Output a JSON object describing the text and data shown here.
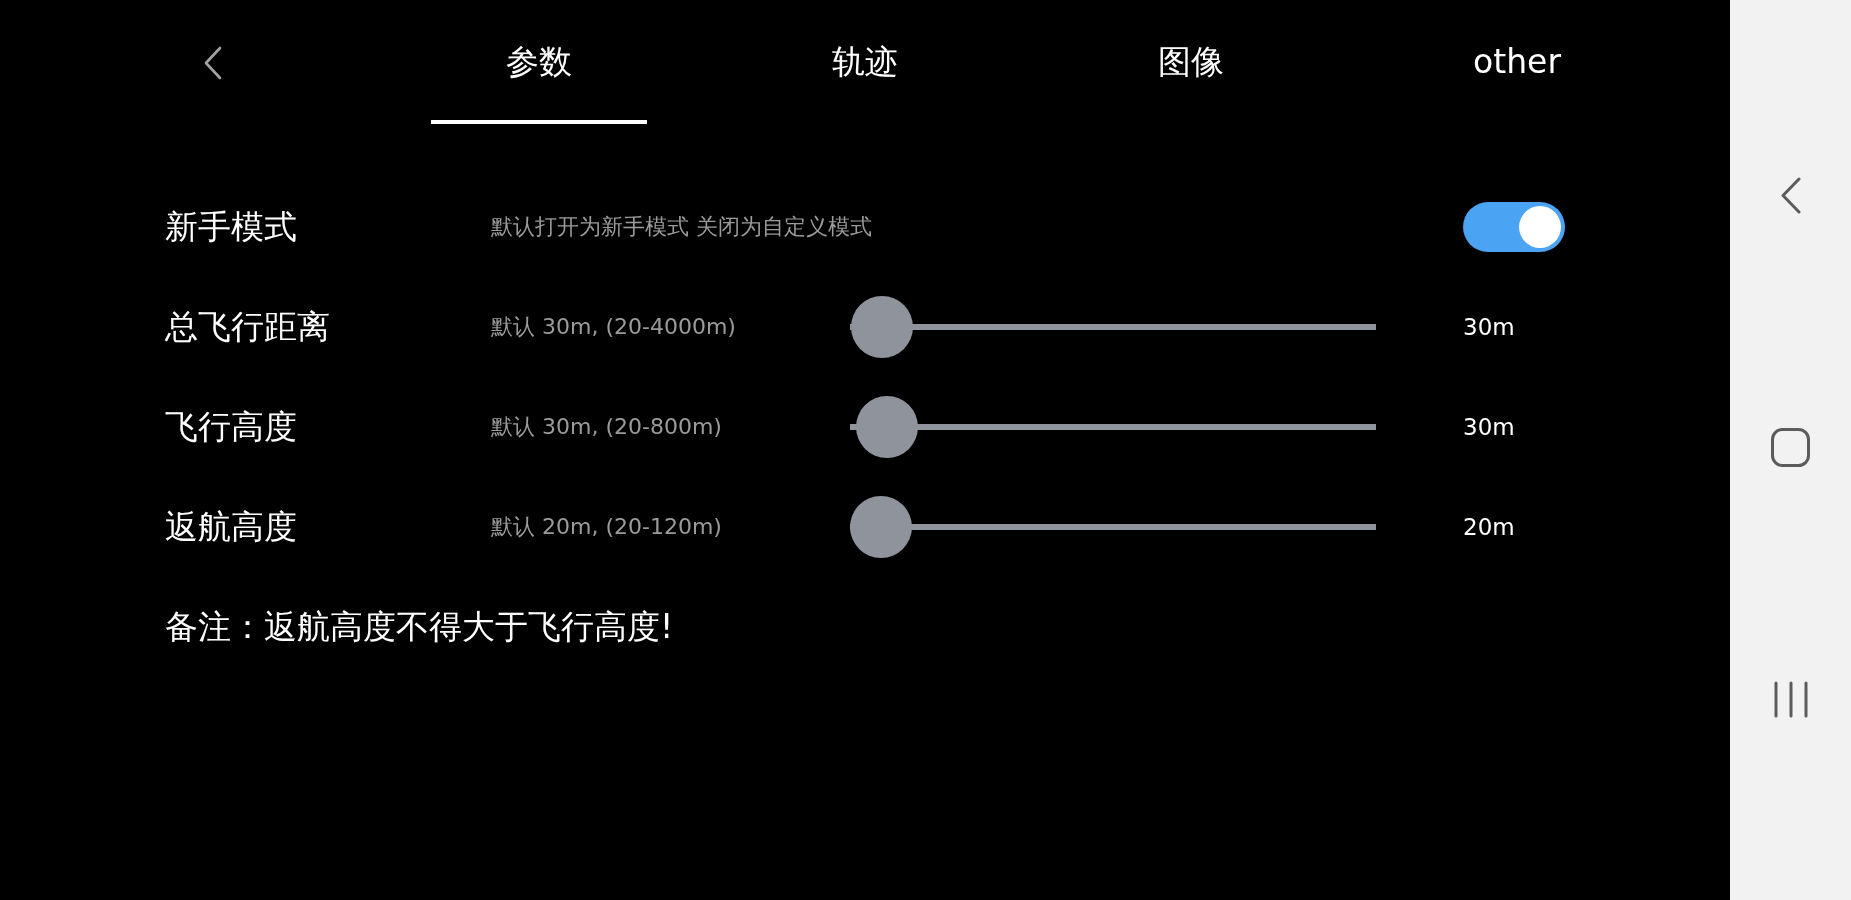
{
  "tab_bar": {
    "tabs": [
      {
        "label": "参数",
        "selected": true
      },
      {
        "label": "轨迹",
        "selected": false
      },
      {
        "label": "图像",
        "selected": false
      },
      {
        "label": "other",
        "selected": false
      }
    ]
  },
  "settings": [
    {
      "kind": "toggle",
      "label": "新手模式",
      "description": "默认打开为新手模式 关闭为自定义模式",
      "on": true
    },
    {
      "kind": "slider",
      "label": "总飞行距离",
      "description": "默认 30m, (20-4000m)",
      "level": 0.003,
      "reading": "30m"
    },
    {
      "kind": "slider",
      "label": "飞行高度",
      "description": "默认 30m, (20-800m)",
      "level": 0.013,
      "reading": "30m"
    },
    {
      "kind": "slider",
      "label": "返航高度",
      "description": "默认 20m, (20-120m)",
      "level": 0,
      "reading": "20m"
    }
  ],
  "note": "备注：返航高度不得大于飞行高度!"
}
